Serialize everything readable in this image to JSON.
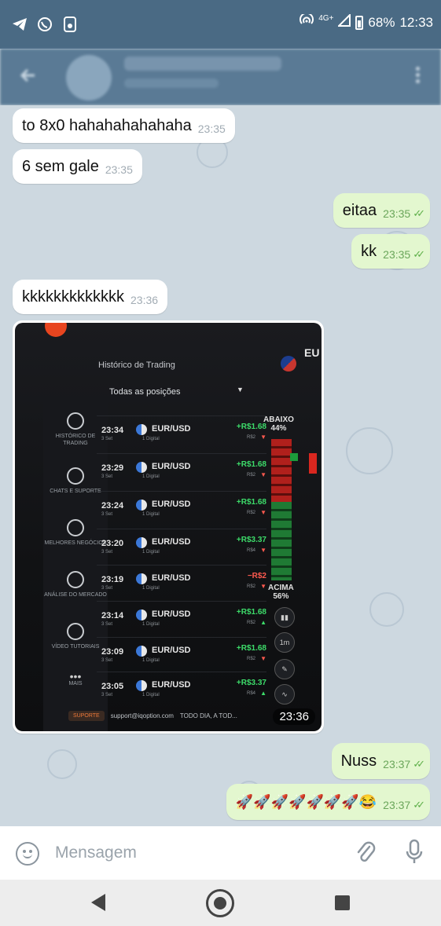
{
  "status_bar": {
    "network": "4G+",
    "battery": "68%",
    "time": "12:33",
    "icons": [
      "telegram-icon",
      "whatsapp-icon",
      "sim-manager-icon",
      "hotspot-icon",
      "signal-icon",
      "battery-icon"
    ]
  },
  "header": {
    "icons": [
      "back-arrow-icon",
      "avatar",
      "more-vertical-icon"
    ]
  },
  "messages": [
    {
      "dir": "in",
      "text": "to 8x0 hahahahahahaha",
      "time": "23:35"
    },
    {
      "dir": "in",
      "text": "6 sem gale",
      "time": "23:35"
    },
    {
      "dir": "out",
      "text": "eitaa",
      "time": "23:35"
    },
    {
      "dir": "out",
      "text": "kk",
      "time": "23:35"
    },
    {
      "dir": "in",
      "text": "kkkkkkkkkkkkk",
      "time": "23:36"
    },
    {
      "dir": "out",
      "text": "Nuss",
      "time": "23:37"
    },
    {
      "dir": "out",
      "text": "🚀🚀🚀🚀🚀🚀🚀😂",
      "time": "23:37"
    }
  ],
  "photo": {
    "time": "23:36",
    "screen": {
      "title": "Histórico de Trading",
      "filter": "Todas as posições",
      "asset_label": "EU",
      "abaixo": "ABAIXO",
      "abaixo_pct": "44%",
      "acima": "ACIMA",
      "acima_pct": "56%",
      "tool_1m": "1m",
      "sidebar": [
        "HISTÓRICO DE TRADING",
        "CHATS E SUPORTE",
        "MELHORES NEGÓCIOS",
        "ANÁLISE DO MERCADO",
        "VÍDEO TUTORIAIS",
        "MAIS"
      ],
      "trades": [
        {
          "time": "23:34",
          "day": "3 Set",
          "pair": "EUR/USD",
          "type": "1 Digital",
          "amount": "+R$1.68",
          "stake": "R$2",
          "dir": "▼",
          "color": "#3ddc6a"
        },
        {
          "time": "23:29",
          "day": "3 Set",
          "pair": "EUR/USD",
          "type": "1 Digital",
          "amount": "+R$1.68",
          "stake": "R$2",
          "dir": "▼",
          "color": "#3ddc6a"
        },
        {
          "time": "23:24",
          "day": "3 Set",
          "pair": "EUR/USD",
          "type": "1 Digital",
          "amount": "+R$1.68",
          "stake": "R$2",
          "dir": "▼",
          "color": "#3ddc6a"
        },
        {
          "time": "23:20",
          "day": "3 Set",
          "pair": "EUR/USD",
          "type": "1 Digital",
          "amount": "+R$3.37",
          "stake": "R$4",
          "dir": "▼",
          "color": "#3ddc6a"
        },
        {
          "time": "23:19",
          "day": "3 Set",
          "pair": "EUR/USD",
          "type": "1 Digital",
          "amount": "−R$2",
          "stake": "R$2",
          "dir": "▼",
          "color": "#ff5a4f"
        },
        {
          "time": "23:14",
          "day": "3 Set",
          "pair": "EUR/USD",
          "type": "1 Digital",
          "amount": "+R$1.68",
          "stake": "R$2",
          "dir": "▲",
          "color": "#3ddc6a"
        },
        {
          "time": "23:09",
          "day": "3 Set",
          "pair": "EUR/USD",
          "type": "1 Digital",
          "amount": "+R$1.68",
          "stake": "R$2",
          "dir": "▼",
          "color": "#3ddc6a"
        },
        {
          "time": "23:05",
          "day": "3 Set",
          "pair": "EUR/USD",
          "type": "1 Digital",
          "amount": "+R$3.37",
          "stake": "R$4",
          "dir": "▲",
          "color": "#3ddc6a"
        }
      ],
      "footer_support": "SUPORTE",
      "footer_email": "support@iqoption.com",
      "footer_hours": "TODO DIA, A TOD..."
    }
  },
  "composer": {
    "placeholder": "Mensagem"
  },
  "colors": {
    "status_bar": "#4a6a84",
    "chat_bg": "#cdd8e0",
    "incoming_bubble": "#ffffff",
    "outgoing_bubble": "#e3f7cf",
    "read_ticks": "#5fb04a"
  }
}
